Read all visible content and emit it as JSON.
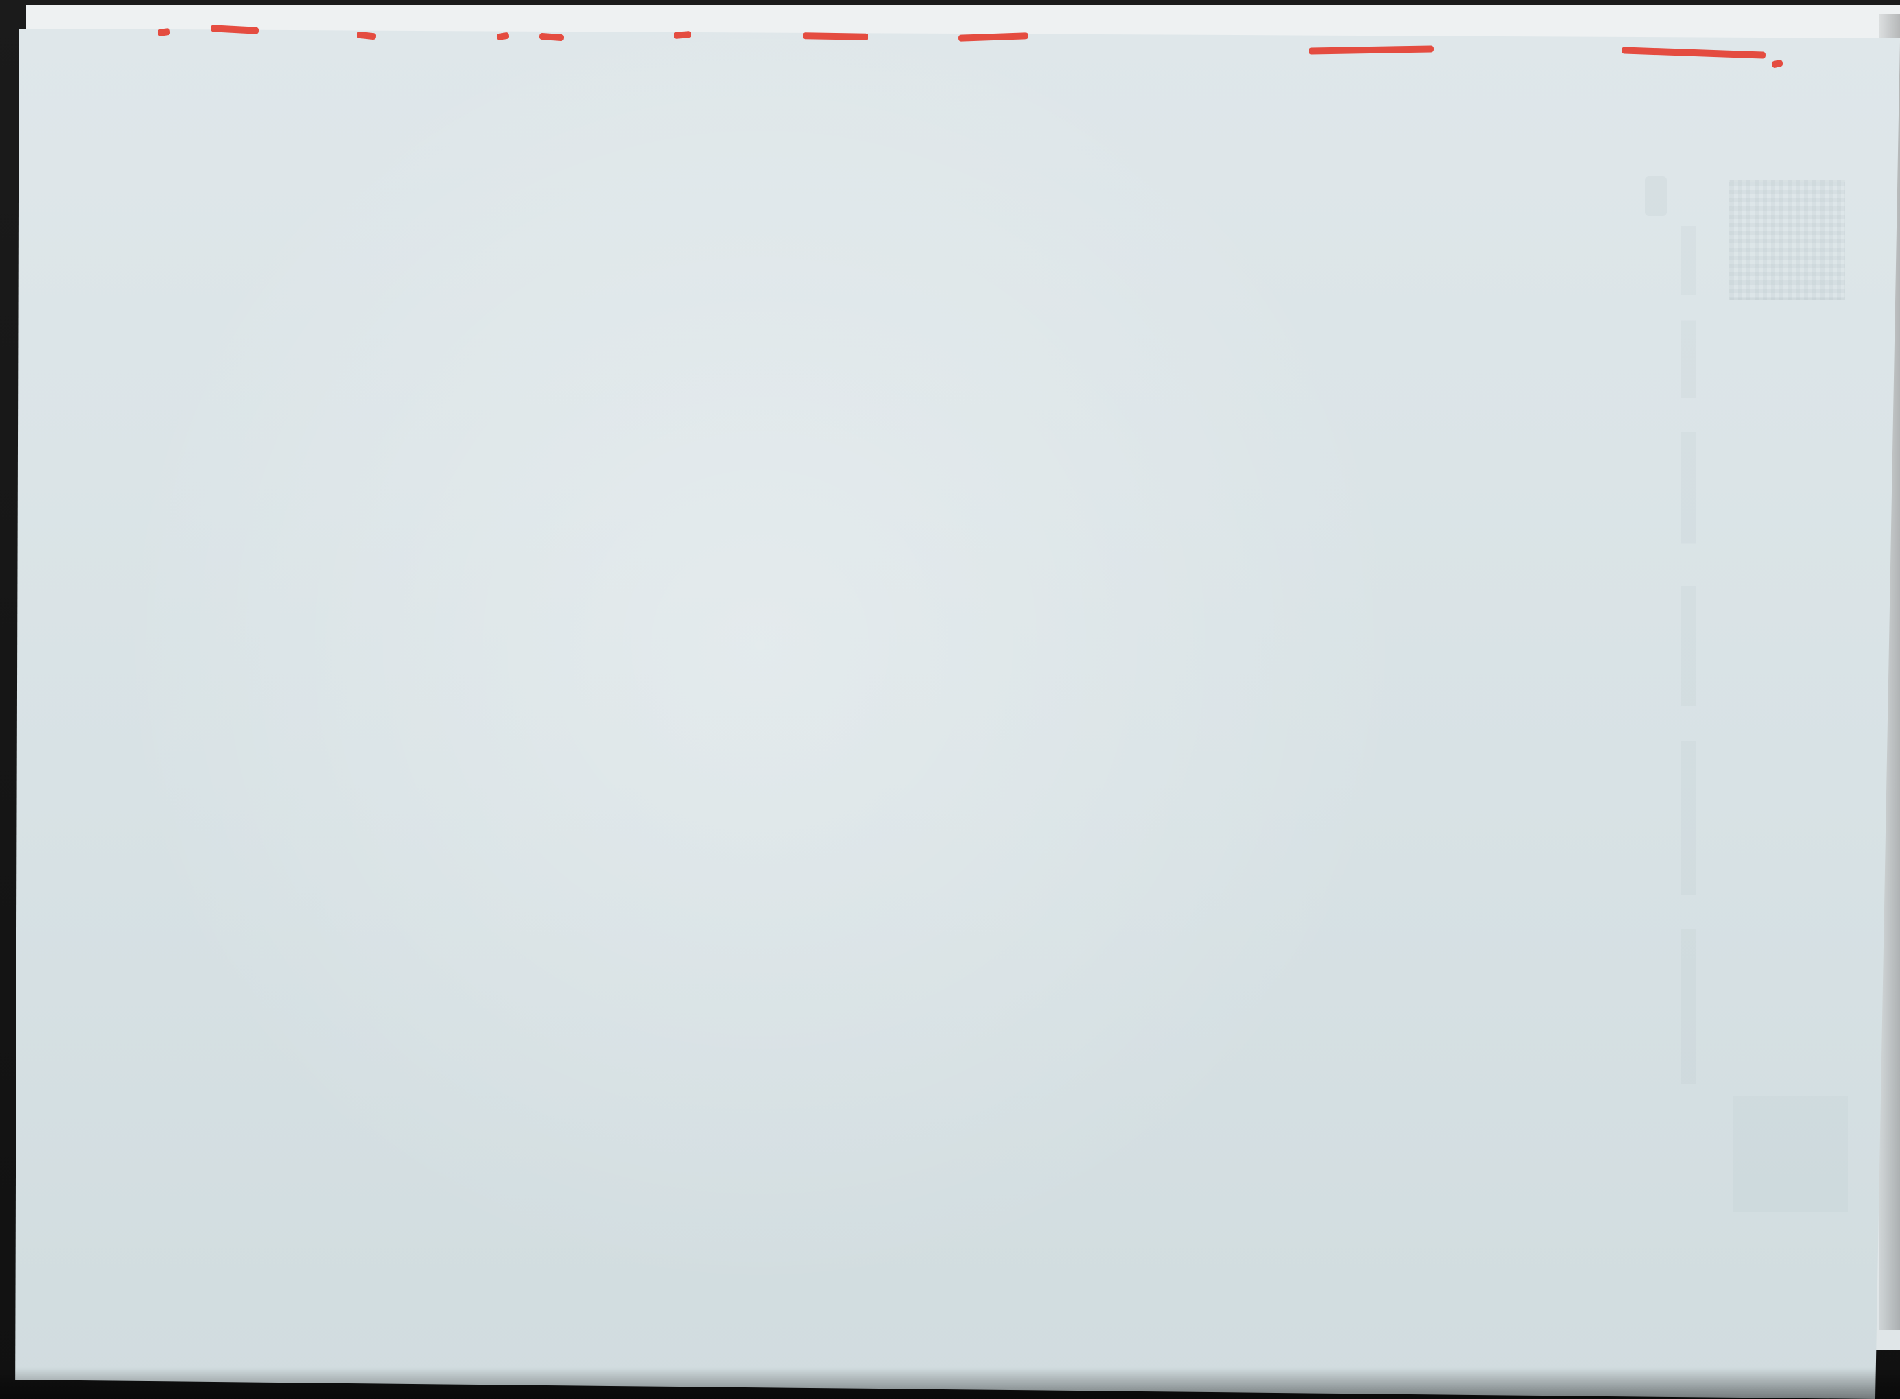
{
  "scene": {
    "background_color": "#161616",
    "paper_color": "#dfe7ea",
    "accent_color": "#e43b2e"
  }
}
